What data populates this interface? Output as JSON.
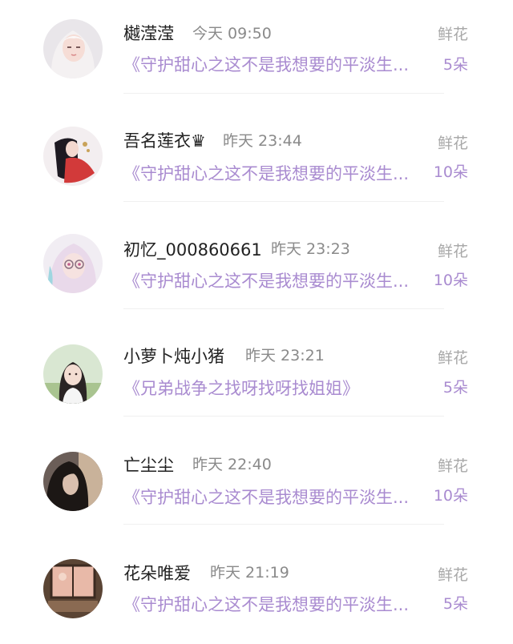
{
  "list": {
    "items": [
      {
        "user": "樾滢滢",
        "time": "今天 09:50",
        "book": "《守护甜心之这不是我想要的平淡生...",
        "gift": "鲜花",
        "count": "5朵",
        "avatar": "avatar-white-hair-girl"
      },
      {
        "user": "吾名莲衣♛",
        "time": "昨天 23:44",
        "book": "《守护甜心之这不是我想要的平淡生...",
        "gift": "鲜花",
        "count": "10朵",
        "avatar": "avatar-red-dress-anime"
      },
      {
        "user": "初忆_000860661",
        "time": "昨天 23:23",
        "book": "《守护甜心之这不是我想要的平淡生...",
        "gift": "鲜花",
        "count": "10朵",
        "avatar": "avatar-pink-hair-glasses"
      },
      {
        "user": "小萝卜炖小猪",
        "time": "昨天 23:21",
        "book": "《兄弟战争之找呀找呀找姐姐》",
        "gift": "鲜花",
        "count": "5朵",
        "avatar": "avatar-girl-photo"
      },
      {
        "user": "亡尘尘",
        "time": "昨天 22:40",
        "book": "《守护甜心之这不是我想要的平淡生...",
        "gift": "鲜花",
        "count": "10朵",
        "avatar": "avatar-dark-hair-girl"
      },
      {
        "user": "花朵唯爱",
        "time": "昨天 21:19",
        "book": "《守护甜心之这不是我想要的平淡生...",
        "gift": "鲜花",
        "count": "5朵",
        "avatar": "avatar-window-scene"
      }
    ]
  }
}
